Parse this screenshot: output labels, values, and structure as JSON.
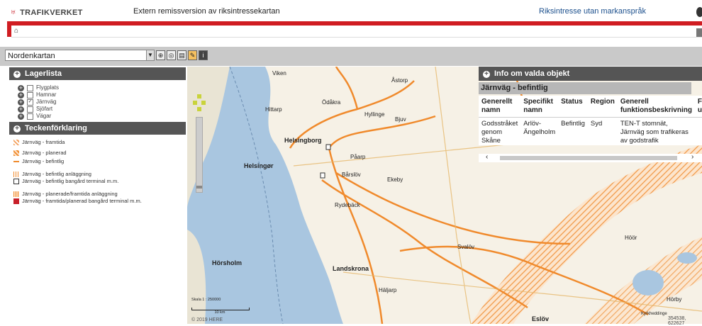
{
  "header": {
    "logo_text": "TRAFIKVERKET",
    "app_title": "Extern remissversion av riksintressekartan",
    "link_title": "Riksintresse utan markanspråk"
  },
  "toolbar": {
    "map_select_value": "Nordenkartan",
    "tool_icons": [
      "chevron-down-icon",
      "zoom-icon",
      "measure-icon",
      "print-icon",
      "draw-icon",
      "info-icon"
    ]
  },
  "layers": {
    "title": "Lagerlista",
    "items": [
      {
        "label": "Flygplats",
        "checked": false
      },
      {
        "label": "Hamnar",
        "checked": false
      },
      {
        "label": "Järnväg",
        "checked": true
      },
      {
        "label": "Sjöfart",
        "checked": false
      },
      {
        "label": "Vägar",
        "checked": false
      }
    ]
  },
  "legend": {
    "title": "Teckenförklaring",
    "items": [
      "Järnväg - framtida",
      "Järnväg - planerad",
      "Järnväg - befintlig",
      "Järnväg - befintlig anläggning",
      "Järnväg - befintlig bangård terminal m.m.",
      "Järnväg - planerade/framtida anläggning",
      "Järnväg - framtida/planerad bangård terminal m.m."
    ]
  },
  "info_panel": {
    "title": "Info om valda objekt",
    "subtitle": "Järnväg - befintlig",
    "columns": [
      "Generellt namn",
      "Specifikt namn",
      "Status",
      "Region",
      "Generell funktionsbeskrivning",
      "Framtida utveckling"
    ],
    "row": [
      "Godsstråket genom Skåne",
      "Arlöv-Ängelholm",
      "Befintlig",
      "Syd",
      "TEN-T stomnät, Järnväg som trafikeras av godstrafik",
      ""
    ]
  },
  "map": {
    "places": [
      "Viken",
      "Åstorp",
      "Ödåkra",
      "Hittarp",
      "Hyllinge",
      "Bjuv",
      "Helsingborg",
      "Påarp",
      "Helsingør",
      "Bårslöv",
      "Ekeby",
      "Rydebäck",
      "Svalöv",
      "Hörsholm",
      "Landskrona",
      "Häljarp",
      "Höör",
      "Eslöv",
      "Hörby",
      "Kyrkheddinge"
    ],
    "scale_label": "Skala 1 : 250000",
    "scale_bar": "10 km",
    "copyright": "© 2019 HERE",
    "coords": "354538, 622627"
  },
  "colors": {
    "accent_red": "#d01d22",
    "panel_dark": "#555555",
    "rail": "#f08a2c"
  }
}
